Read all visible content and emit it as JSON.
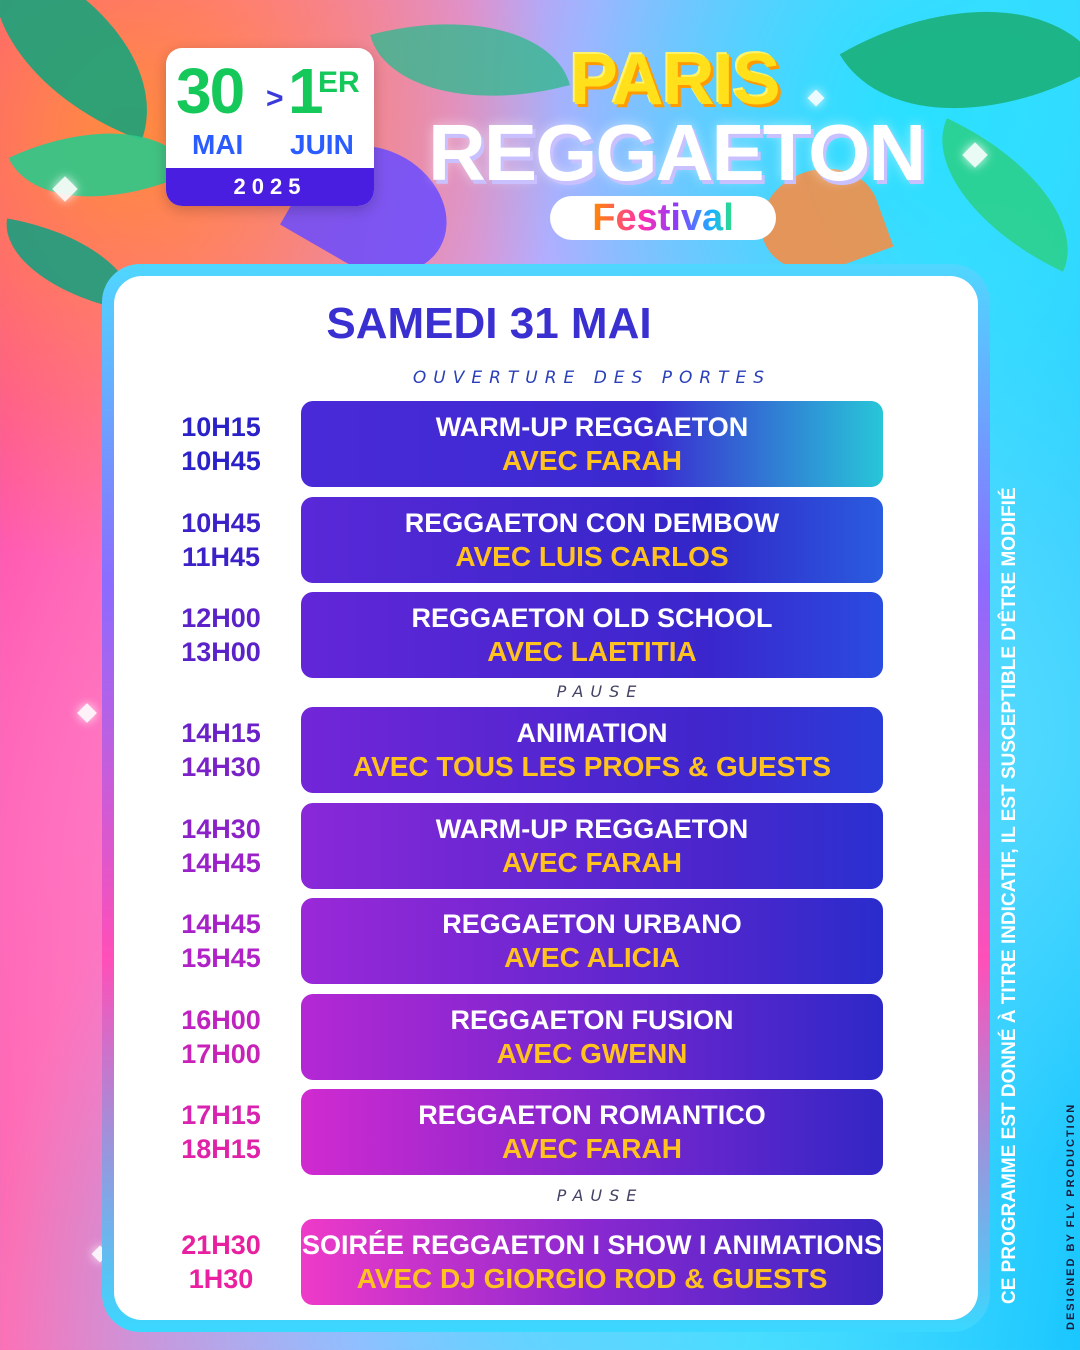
{
  "date_badge": {
    "start_day": "30",
    "arrow": ">",
    "end_day": "1",
    "end_suffix": "ER",
    "start_month": "MAI",
    "end_month": "JUIN",
    "year": "2025"
  },
  "logo": {
    "line1": "PARIS",
    "line2": "REGGAETON",
    "line3": "Festival"
  },
  "schedule": {
    "day": "SAMEDI 31 MAI",
    "opening": "OUVERTURE DES PORTES",
    "pause_label": "PAUSE",
    "rows": [
      {
        "start": "10H15",
        "end": "10H45",
        "title": "WARM-UP REGGAETON",
        "with": "AVEC FARAH"
      },
      {
        "start": "10H45",
        "end": "11H45",
        "title": "REGGAETON CON DEMBOW",
        "with": "AVEC LUIS CARLOS"
      },
      {
        "start": "12H00",
        "end": "13H00",
        "title": "REGGAETON OLD SCHOOL",
        "with": "AVEC LAETITIA"
      },
      {
        "start": "14H15",
        "end": "14H30",
        "title": "ANIMATION",
        "with": "AVEC TOUS LES PROFS & GUESTS"
      },
      {
        "start": "14H30",
        "end": "14H45",
        "title": "WARM-UP REGGAETON",
        "with": "AVEC FARAH"
      },
      {
        "start": "14H45",
        "end": "15H45",
        "title": "REGGAETON URBANO",
        "with": "AVEC ALICIA"
      },
      {
        "start": "16H00",
        "end": "17H00",
        "title": "REGGAETON FUSION",
        "with": "AVEC GWENN"
      },
      {
        "start": "17H15",
        "end": "18H15",
        "title": "REGGAETON ROMANTICO",
        "with": "AVEC FARAH"
      },
      {
        "start": "21H30",
        "end": "1H30",
        "title": "SOIRÉE REGGAETON I SHOW I ANIMATIONS",
        "with": "AVEC DJ GIORGIO ROD & GUESTS"
      }
    ]
  },
  "side_note": "CE PROGRAMME EST DONNÉ À TITRE INDICATIF, IL EST SUSCEPTIBLE D'ÊTRE MODIFIÉ",
  "credit": "DESIGNED BY FLY PRODUCTION",
  "colors": {
    "title_blue": "#3a2fd0",
    "highlight_yellow": "#ffc21f",
    "badge_green": "#14c85a",
    "box_gradient_from": "#6d2bd9",
    "box_gradient_to": "#2a22c8"
  }
}
